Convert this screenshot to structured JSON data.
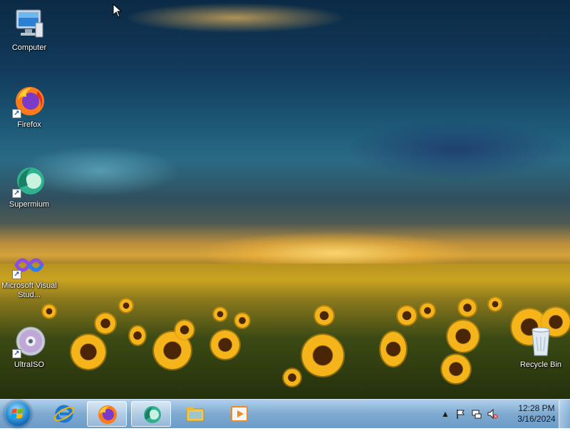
{
  "desktop": {
    "icons": [
      {
        "label": "Computer",
        "icon": "computer-icon"
      },
      {
        "label": "Firefox",
        "icon": "firefox-icon"
      },
      {
        "label": "Supermium",
        "icon": "supermium-icon"
      },
      {
        "label": "Microsoft Visual Stud...",
        "icon": "visual-studio-icon"
      },
      {
        "label": "UltraISO",
        "icon": "ultraiso-icon"
      },
      {
        "label": "Recycle Bin",
        "icon": "recycle-bin-icon"
      }
    ]
  },
  "taskbar": {
    "start_icon": "windows-start-icon",
    "pinned": [
      {
        "icon": "internet-explorer-icon"
      },
      {
        "icon": "firefox-icon",
        "active": true
      },
      {
        "icon": "supermium-icon",
        "active": true
      },
      {
        "icon": "file-explorer-icon"
      },
      {
        "icon": "media-player-icon"
      }
    ],
    "tray": {
      "icons": [
        "show-hidden-icons-arrow",
        "action-center-flag-icon",
        "network-icon",
        "volume-muted-icon"
      ]
    },
    "clock": {
      "time": "12:28 PM",
      "date": "3/16/2024"
    }
  },
  "colors": {
    "taskbar": "#8fb6d9",
    "text": "#ffffff"
  }
}
